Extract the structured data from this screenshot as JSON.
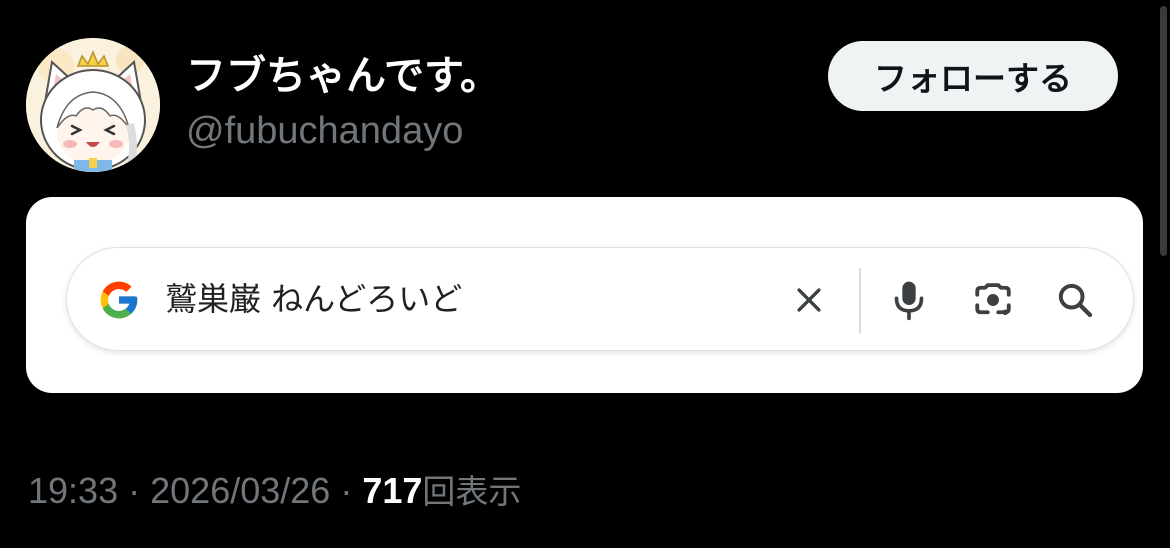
{
  "post": {
    "author": {
      "display_name": "フブちゃんです。",
      "handle": "@fubuchandayo"
    },
    "follow_label": "フォローする",
    "meta": {
      "time": "19:33",
      "separator": "·",
      "date": "2026/03/26",
      "view_count": "717",
      "views_label": "回表示"
    }
  },
  "search": {
    "query": "鷲巣巌 ねんどろいど",
    "icons": [
      "google-logo",
      "clear-icon",
      "mic-icon",
      "lens-camera-icon",
      "search-icon"
    ]
  },
  "colors": {
    "background": "#000000",
    "secondary_text": "#71767b",
    "follow_button_bg": "#eff3f4",
    "card_bg": "#ffffff"
  }
}
